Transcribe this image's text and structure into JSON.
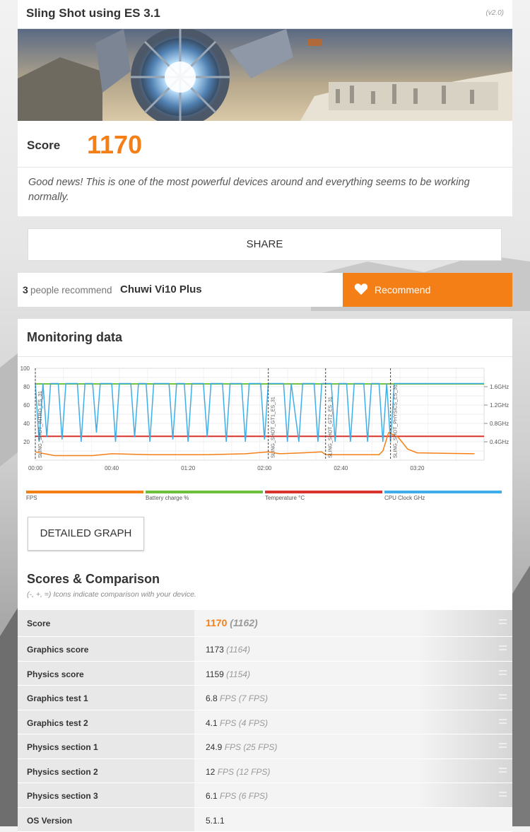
{
  "header": {
    "title": "Sling Shot using ES 3.1",
    "version": "(v2.0)",
    "score_label": "Score",
    "score_value": "1170",
    "message": "Good news! This is one of the most powerful devices around and everything seems to be working normally."
  },
  "share": {
    "label": "SHARE"
  },
  "recommend": {
    "count": "3",
    "text": "people recommend",
    "device": "Chuwi Vi10 Plus",
    "button_label": "Recommend",
    "icon": "heart-icon"
  },
  "monitoring": {
    "title": "Monitoring data",
    "detailed_button": "DETAILED GRAPH",
    "legend": [
      {
        "label": "FPS",
        "color": "#f57f17"
      },
      {
        "label": "Battery charge %",
        "color": "#6cbf3b"
      },
      {
        "label": "Temperature °C",
        "color": "#d9342b"
      },
      {
        "label": "CPU Clock GHz",
        "color": "#3daee9"
      }
    ]
  },
  "chart_data": {
    "type": "line",
    "x_ticks": [
      "00:00",
      "00:40",
      "01:20",
      "02:00",
      "02:40",
      "03:20"
    ],
    "y_left_ticks": [
      "100",
      "80",
      "60",
      "40",
      "20"
    ],
    "y_right_ticks": [
      "1.6GHz",
      "1.2GHz",
      "0.8GHz",
      "0.4GHz"
    ],
    "ylim_left": [
      0,
      100
    ],
    "ylim_right": [
      0,
      2.0
    ],
    "xlim_seconds": [
      0,
      235
    ],
    "markers": [
      {
        "t": 0,
        "label": "SLING_SHOT_INTRO_ES_31"
      },
      {
        "t": 122,
        "label": "SLING_SHOT_GT1_ES_31"
      },
      {
        "t": 152,
        "label": "SLING_SHOT_GT2_ES_31"
      },
      {
        "t": 186,
        "label": "SLING_SHOT_PHYSICS_ES_31"
      }
    ],
    "series": [
      {
        "name": "Battery charge %",
        "color": "#6cbf3b",
        "points": [
          [
            0,
            83
          ],
          [
            235,
            83
          ]
        ]
      },
      {
        "name": "Temperature °C",
        "color": "#d9342b",
        "points": [
          [
            0,
            26
          ],
          [
            235,
            26
          ]
        ]
      },
      {
        "name": "FPS",
        "color": "#f57f17",
        "points": [
          [
            0,
            9
          ],
          [
            10,
            5
          ],
          [
            30,
            5
          ],
          [
            40,
            7
          ],
          [
            60,
            6
          ],
          [
            90,
            6
          ],
          [
            110,
            7
          ],
          [
            122,
            9
          ],
          [
            128,
            7
          ],
          [
            140,
            8
          ],
          [
            150,
            9
          ],
          [
            152,
            6
          ],
          [
            180,
            6
          ],
          [
            182,
            10
          ],
          [
            185,
            30
          ],
          [
            190,
            25
          ],
          [
            195,
            12
          ],
          [
            200,
            8
          ],
          [
            230,
            7
          ]
        ]
      },
      {
        "name": "CPU Clock GHz",
        "color": "#3daee9",
        "pattern": "oscillating",
        "high": 1.67,
        "low": 0.4,
        "points": [
          [
            0,
            1.67
          ],
          [
            2,
            0.4
          ],
          [
            4,
            1.67
          ],
          [
            6,
            0.5
          ],
          [
            8,
            1.67
          ],
          [
            12,
            1.67
          ],
          [
            14,
            0.45
          ],
          [
            16,
            1.67
          ],
          [
            22,
            1.67
          ],
          [
            24,
            0.4
          ],
          [
            26,
            1.67
          ],
          [
            30,
            1.67
          ],
          [
            32,
            0.6
          ],
          [
            34,
            1.67
          ],
          [
            40,
            1.67
          ],
          [
            42,
            0.4
          ],
          [
            44,
            1.67
          ],
          [
            50,
            1.67
          ],
          [
            52,
            0.5
          ],
          [
            54,
            1.67
          ],
          [
            58,
            1.67
          ],
          [
            60,
            0.4
          ],
          [
            62,
            1.67
          ],
          [
            70,
            1.67
          ],
          [
            72,
            0.45
          ],
          [
            74,
            1.67
          ],
          [
            78,
            1.67
          ],
          [
            80,
            0.4
          ],
          [
            82,
            1.67
          ],
          [
            88,
            1.67
          ],
          [
            90,
            0.5
          ],
          [
            92,
            1.67
          ],
          [
            98,
            1.67
          ],
          [
            100,
            0.4
          ],
          [
            102,
            1.67
          ],
          [
            108,
            1.67
          ],
          [
            110,
            0.4
          ],
          [
            112,
            1.67
          ],
          [
            118,
            1.67
          ],
          [
            120,
            0.45
          ],
          [
            122,
            1.67
          ],
          [
            130,
            1.67
          ],
          [
            132,
            0.4
          ],
          [
            134,
            1.67
          ],
          [
            138,
            0.4
          ],
          [
            140,
            1.67
          ],
          [
            146,
            1.67
          ],
          [
            148,
            0.4
          ],
          [
            150,
            1.67
          ],
          [
            155,
            1.67
          ],
          [
            157,
            0.4
          ],
          [
            159,
            1.67
          ],
          [
            163,
            1.67
          ],
          [
            165,
            0.4
          ],
          [
            167,
            1.67
          ],
          [
            172,
            1.67
          ],
          [
            174,
            0.4
          ],
          [
            176,
            1.67
          ],
          [
            180,
            1.67
          ],
          [
            182,
            0.4
          ],
          [
            184,
            1.67
          ],
          [
            186,
            0.4
          ],
          [
            188,
            1.67
          ],
          [
            235,
            1.67
          ]
        ]
      }
    ]
  },
  "scores": {
    "title": "Scores & Comparison",
    "note": "(-, +, =) Icons indicate comparison with your device.",
    "rows": [
      {
        "label": "Score",
        "value": "1170",
        "unit": "",
        "compare": "(1162)",
        "icon": "equal-icon"
      },
      {
        "label": "Graphics score",
        "value": "1173",
        "unit": "",
        "compare": "(1164)",
        "icon": "equal-icon"
      },
      {
        "label": "Physics score",
        "value": "1159",
        "unit": "",
        "compare": "(1154)",
        "icon": "equal-icon"
      },
      {
        "label": "Graphics test 1",
        "value": "6.8",
        "unit": "FPS",
        "compare": "(7 FPS)",
        "icon": "equal-icon"
      },
      {
        "label": "Graphics test 2",
        "value": "4.1",
        "unit": "FPS",
        "compare": "(4 FPS)",
        "icon": "equal-icon"
      },
      {
        "label": "Physics section 1",
        "value": "24.9",
        "unit": "FPS",
        "compare": "(25 FPS)",
        "icon": "equal-icon"
      },
      {
        "label": "Physics section 2",
        "value": "12",
        "unit": "FPS",
        "compare": "(12 FPS)",
        "icon": "equal-icon"
      },
      {
        "label": "Physics section 3",
        "value": "6.1",
        "unit": "FPS",
        "compare": "(6 FPS)",
        "icon": "equal-icon"
      },
      {
        "label": "OS Version",
        "value": "5.1.1",
        "unit": "",
        "compare": "",
        "icon": ""
      }
    ]
  }
}
